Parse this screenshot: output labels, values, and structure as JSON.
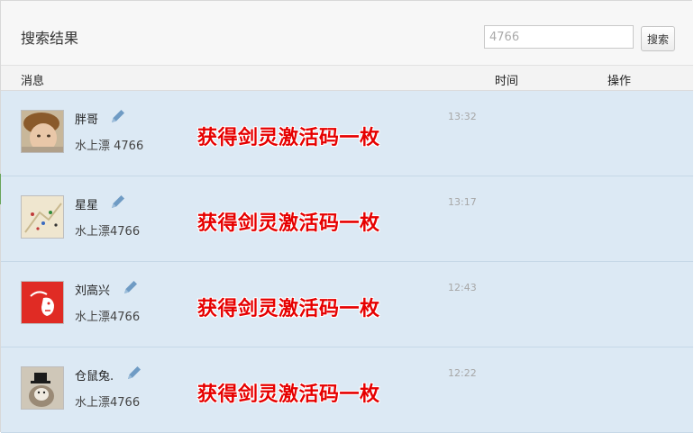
{
  "header": {
    "title": "搜索结果",
    "search_value": "4766",
    "search_button": "搜索"
  },
  "columns": {
    "message": "消息",
    "time": "时间",
    "action": "操作"
  },
  "rows": [
    {
      "name": "胖哥",
      "subtitle": "水上漂 4766",
      "message": "获得剑灵激活码一枚",
      "time": "13:32",
      "avatar": "boy-photo"
    },
    {
      "name": "星星",
      "subtitle": "水上漂4766",
      "message": "获得剑灵激活码一枚",
      "time": "13:17",
      "avatar": "map-photo"
    },
    {
      "name": "刘高兴",
      "subtitle": "水上漂4766",
      "message": "获得剑灵激活码一枚",
      "time": "12:43",
      "avatar": "red-goat-logo"
    },
    {
      "name": "仓鼠兔.",
      "subtitle": "水上漂4766",
      "message": "获得剑灵激活码一枚",
      "time": "12:22",
      "avatar": "rabbit-hat-photo"
    }
  ],
  "colors": {
    "message_red": "#e60000",
    "row_bg": "#dce9f4",
    "edit_icon": "#6f9bc4"
  }
}
